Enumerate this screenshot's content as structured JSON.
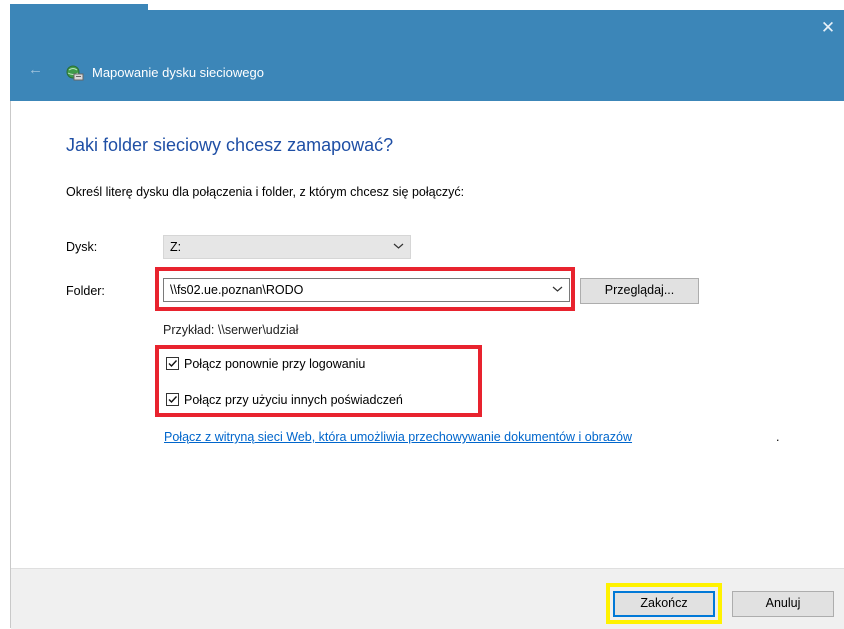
{
  "window": {
    "title": "Mapowanie dysku sieciowego",
    "close_glyph": "✕",
    "back_glyph": "←"
  },
  "colors": {
    "titlebar": "#3c86b8",
    "heading": "#1f4fa5",
    "link": "#0066cc",
    "highlight_red": "#e8232e",
    "highlight_yellow": "#fff200"
  },
  "icons": [
    "back-arrow-icon",
    "network-drive-icon",
    "close-icon",
    "chevron-down-icon",
    "checkmark-icon"
  ],
  "main": {
    "heading": "Jaki folder sieciowy chcesz zamapować?",
    "instruction": "Określ literę dysku dla połączenia i folder, z którym chcesz się połączyć:",
    "drive_label": "Dysk:",
    "drive_value": "Z:",
    "folder_label": "Folder:",
    "folder_value": "\\\\fs02.ue.poznan\\RODO",
    "browse_label": "Przeglądaj...",
    "example": "Przykład: \\\\serwer\\udział",
    "reconnect_label": "Połącz ponownie przy logowaniu",
    "reconnect_checked": true,
    "credentials_label": "Połącz przy użyciu innych poświadczeń",
    "credentials_checked": true,
    "link_text": "Połącz z witryną sieci Web, która umożliwia przechowywanie dokumentów i obrazów",
    "link_suffix": "."
  },
  "footer": {
    "finish_label": "Zakończ",
    "cancel_label": "Anuluj"
  }
}
